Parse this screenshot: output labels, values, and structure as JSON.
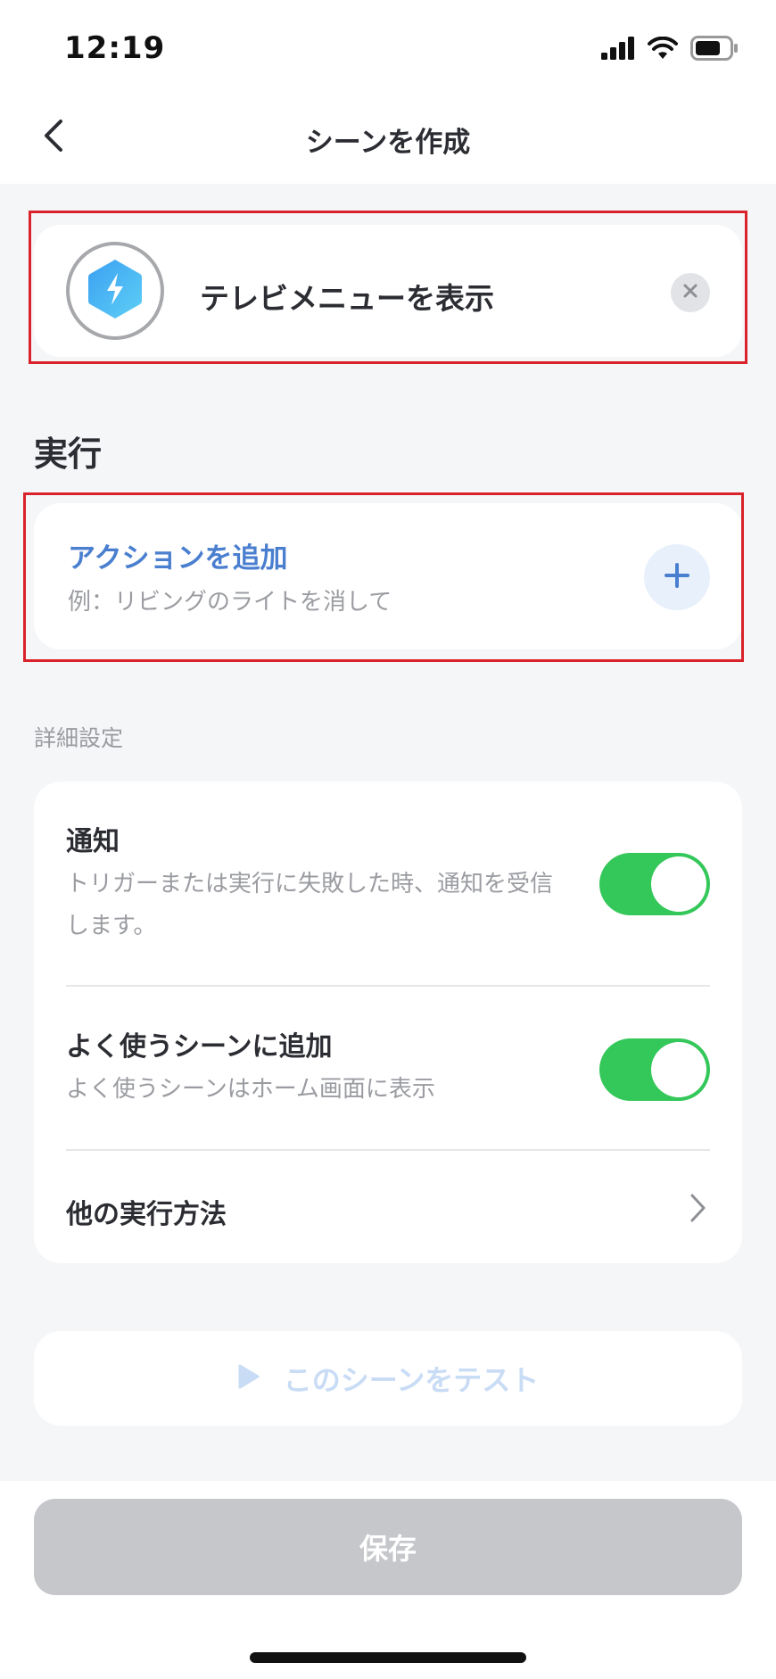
{
  "status_bar": {
    "time": "12:19"
  },
  "header": {
    "title": "シーンを作成",
    "back_icon": "chevron-left-icon"
  },
  "scene": {
    "name": "テレビメニューを表示",
    "icon": "lightning-hexagon-icon",
    "clear_icon": "close-icon"
  },
  "execute": {
    "section_title": "実行",
    "action_title": "アクションを追加",
    "action_hint": "例：リビングのライトを消して",
    "add_icon": "plus-icon"
  },
  "advanced": {
    "label": "詳細設定",
    "items": [
      {
        "title": "通知",
        "description": "トリガーまたは実行に失敗した時、通知を受信します。",
        "enabled": true
      },
      {
        "title": "よく使うシーンに追加",
        "description": "よく使うシーンはホーム画面に表示",
        "enabled": true
      },
      {
        "title": "他の実行方法"
      }
    ]
  },
  "test": {
    "label": "このシーンをテスト",
    "icon": "play-icon"
  },
  "footer": {
    "save_label": "保存"
  },
  "colors": {
    "accent": "#4a7fcf",
    "toggle_on": "#34c759",
    "highlight_box": "#d9222a",
    "save_disabled": "#c6c7cb"
  }
}
